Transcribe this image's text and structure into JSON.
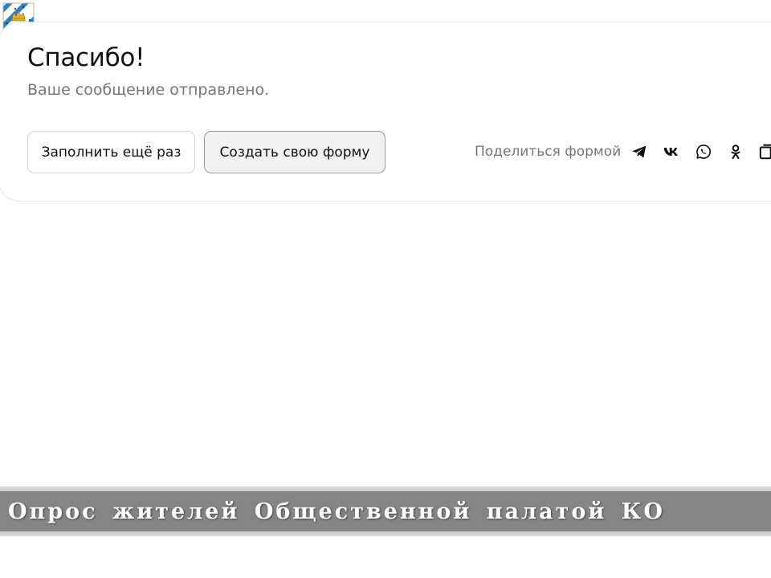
{
  "form_result": {
    "title": "Спасибо!",
    "message": "Ваше сообщение отправлено.",
    "refill_label": "Заполнить ещё раз",
    "create_label": "Создать свою форму"
  },
  "share": {
    "label": "Поделиться формой",
    "icons": [
      "telegram-icon",
      "vk-icon",
      "whatsapp-icon",
      "odnoklassniki-icon",
      "copy-link-icon"
    ]
  },
  "slide": {
    "banner_title": "Опрос жителей Общественной палатой КО"
  },
  "colors": {
    "banner": "#858585",
    "text_secondary": "#777777",
    "card_border": "#e6e6e6",
    "coat_blue": "#2f7fc1",
    "coat_gold": "#e8b523"
  }
}
